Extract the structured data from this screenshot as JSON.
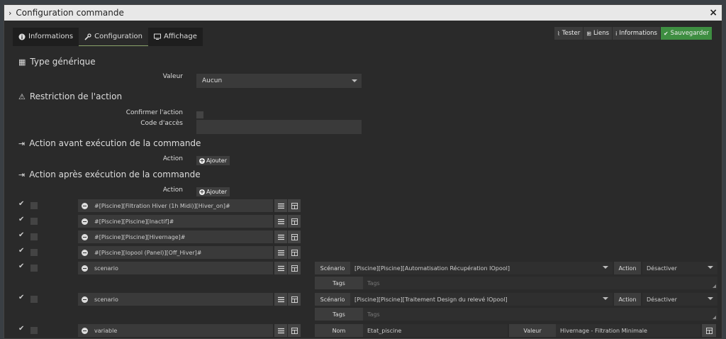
{
  "modal": {
    "title": "Configuration commande",
    "close": "×"
  },
  "tabs": [
    {
      "label": "Informations"
    },
    {
      "label": "Configuration"
    },
    {
      "label": "Affichage"
    }
  ],
  "toolbar": {
    "test": "Tester",
    "links": "Liens",
    "info": "Informations",
    "save": "Sauvegarder"
  },
  "generic_type": {
    "title": "Type générique",
    "value_label": "Valeur",
    "value": "Aucun"
  },
  "restriction": {
    "title": "Restriction de l'action",
    "confirm_label": "Confirmer l'action",
    "access_label": "Code d'accès"
  },
  "before": {
    "title": "Action avant exécution de la commande",
    "action_label": "Action",
    "add": "Ajouter"
  },
  "after": {
    "title": "Action après exécution de la commande",
    "action_label": "Action",
    "add": "Ajouter"
  },
  "actions": [
    {
      "cmd": "#[Piscine][Filtration Hiver (1h Midi)][Hiver_on]#"
    },
    {
      "cmd": "#[Piscine][Piscine][Inactif]#"
    },
    {
      "cmd": "#[Piscine][Piscine][Hivernage]#"
    },
    {
      "cmd": "#[Piscine][Iopool (Panel)][Off_Hiver]#"
    },
    {
      "cmd": "scenario"
    },
    {
      "cmd": "scenario"
    },
    {
      "cmd": "variable"
    }
  ],
  "scenario_opts": [
    {
      "scenario_label": "Scénario",
      "scenario": "[Piscine][Piscine][Automatisation Récupération IOpool]",
      "action_label": "Action",
      "action": "Désactiver",
      "tags_label": "Tags",
      "tags_placeholder": "Tags"
    },
    {
      "scenario_label": "Scénario",
      "scenario": "[Piscine][Piscine][Traitement Design du relevé IOpool]",
      "action_label": "Action",
      "action": "Désactiver",
      "tags_label": "Tags",
      "tags_placeholder": "Tags"
    }
  ],
  "variable_opts": {
    "name_label": "Nom",
    "name": "Etat_piscine",
    "value_label": "Valeur",
    "value": "Hivernage - Filtration Minimale"
  }
}
